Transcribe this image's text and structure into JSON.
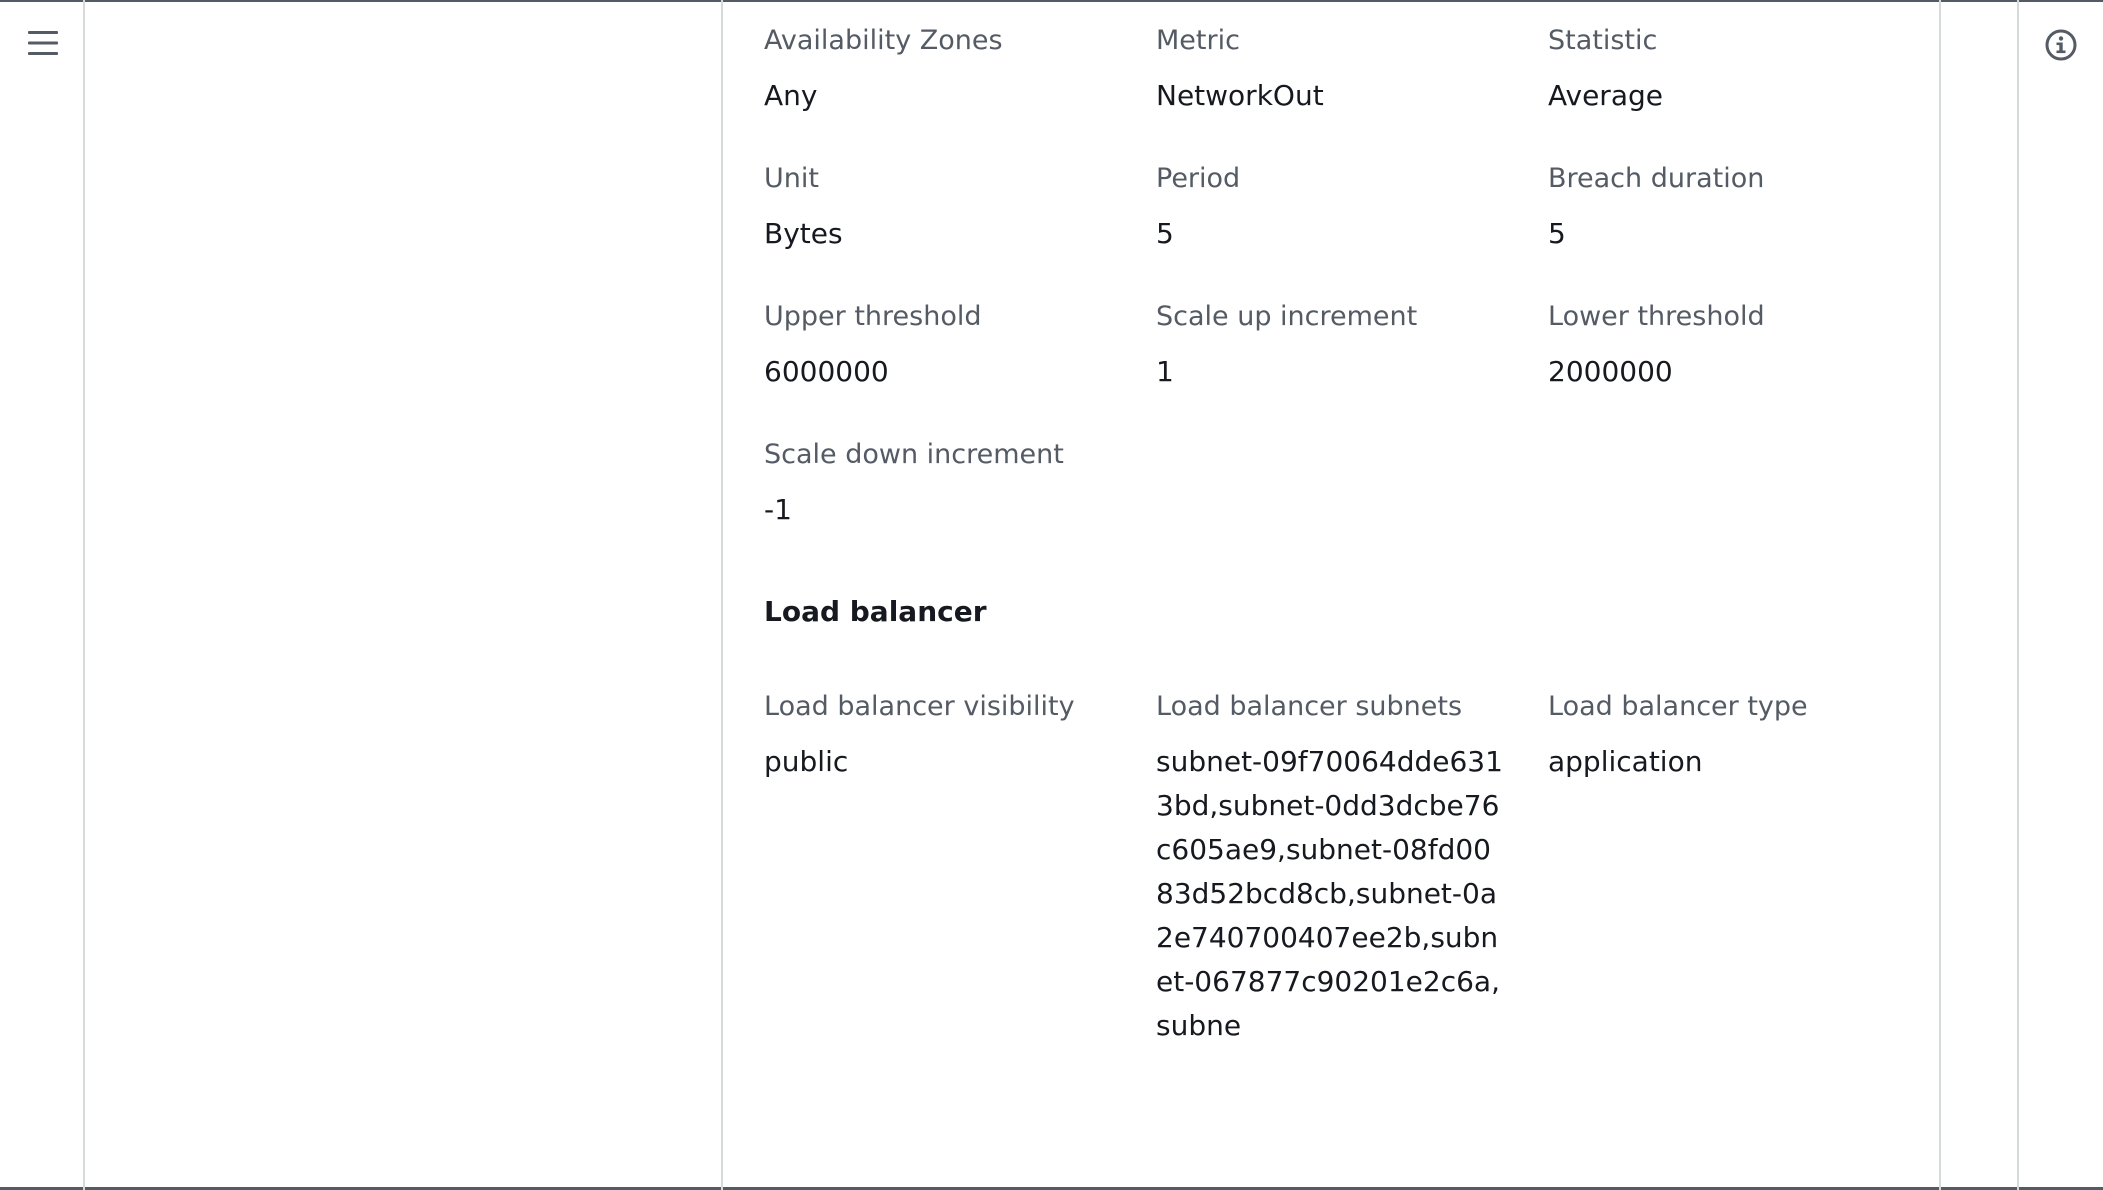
{
  "icons": {
    "menu": "hamburger-menu-icon",
    "info": "info-circle-icon"
  },
  "scaling_fields": [
    {
      "label": "Availability Zones",
      "value": "Any"
    },
    {
      "label": "Metric",
      "value": "NetworkOut"
    },
    {
      "label": "Statistic",
      "value": "Average"
    },
    {
      "label": "Unit",
      "value": "Bytes"
    },
    {
      "label": "Period",
      "value": "5"
    },
    {
      "label": "Breach duration",
      "value": "5"
    },
    {
      "label": "Upper threshold",
      "value": "6000000"
    },
    {
      "label": "Scale up increment",
      "value": "1"
    },
    {
      "label": "Lower threshold",
      "value": "2000000"
    },
    {
      "label": "Scale down increment",
      "value": "-1"
    }
  ],
  "load_balancer": {
    "section_title": "Load balancer",
    "fields": [
      {
        "label": "Load balancer visibility",
        "value": "public"
      },
      {
        "label": "Load balancer subnets",
        "value": "subnet-09f70064dde6313bd,subnet-0dd3dcbe76c605ae9,subnet-08fd0083d52bcd8cb,subnet-0a2e740700407ee2b,subnet-067877c90201e2c6a,subne"
      },
      {
        "label": "Load balancer type",
        "value": "application"
      }
    ]
  }
}
